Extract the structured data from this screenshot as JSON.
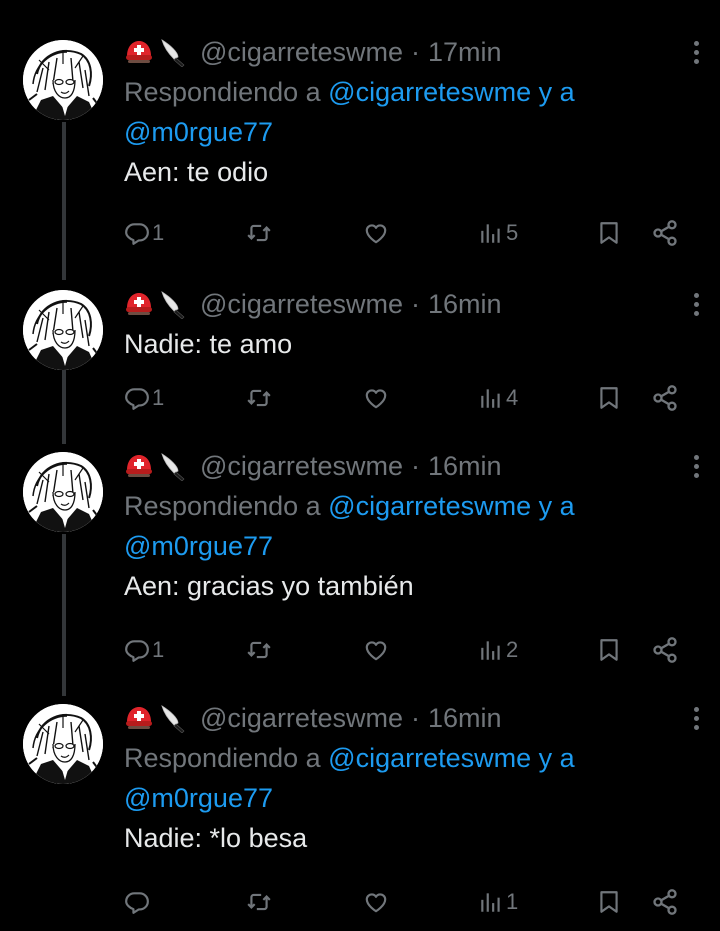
{
  "colors": {
    "background": "#000000",
    "text": "#e7e9ea",
    "secondary": "#71767b",
    "mention": "#1d9bf0",
    "thread_line": "#333639"
  },
  "icons": {
    "name_emoji": [
      "rescue-helmet-emoji",
      "knife-emoji"
    ],
    "actions": [
      "reply-icon",
      "retweet-icon",
      "like-icon",
      "views-icon",
      "bookmark-icon",
      "share-icon"
    ],
    "more": "more-options-icon"
  },
  "tweets": [
    {
      "handle": "@cigarreteswme",
      "separator": "·",
      "time": "17min",
      "replying_prefix": "Respondiendo a ",
      "replying_mention1": "@cigarreteswme",
      "replying_join": " y a",
      "replying_mention2": "@m0rgue77",
      "text": "Aen: te odio",
      "reply_count": "1",
      "retweet_count": "",
      "like_count": "",
      "view_count": "5"
    },
    {
      "handle": "@cigarreteswme",
      "separator": "·",
      "time": "16min",
      "text": "Nadie: te amo",
      "reply_count": "1",
      "retweet_count": "",
      "like_count": "",
      "view_count": "4"
    },
    {
      "handle": "@cigarreteswme",
      "separator": "·",
      "time": "16min",
      "replying_prefix": "Respondiendo a ",
      "replying_mention1": "@cigarreteswme",
      "replying_join": " y a",
      "replying_mention2": "@m0rgue77",
      "text": "Aen: gracias yo también",
      "reply_count": "1",
      "retweet_count": "",
      "like_count": "",
      "view_count": "2"
    },
    {
      "handle": "@cigarreteswme",
      "separator": "·",
      "time": "16min",
      "replying_prefix": "Respondiendo a ",
      "replying_mention1": "@cigarreteswme",
      "replying_join": " y a",
      "replying_mention2": "@m0rgue77",
      "text": "Nadie: *lo besa",
      "reply_count": "",
      "retweet_count": "",
      "like_count": "",
      "view_count": "1"
    }
  ]
}
